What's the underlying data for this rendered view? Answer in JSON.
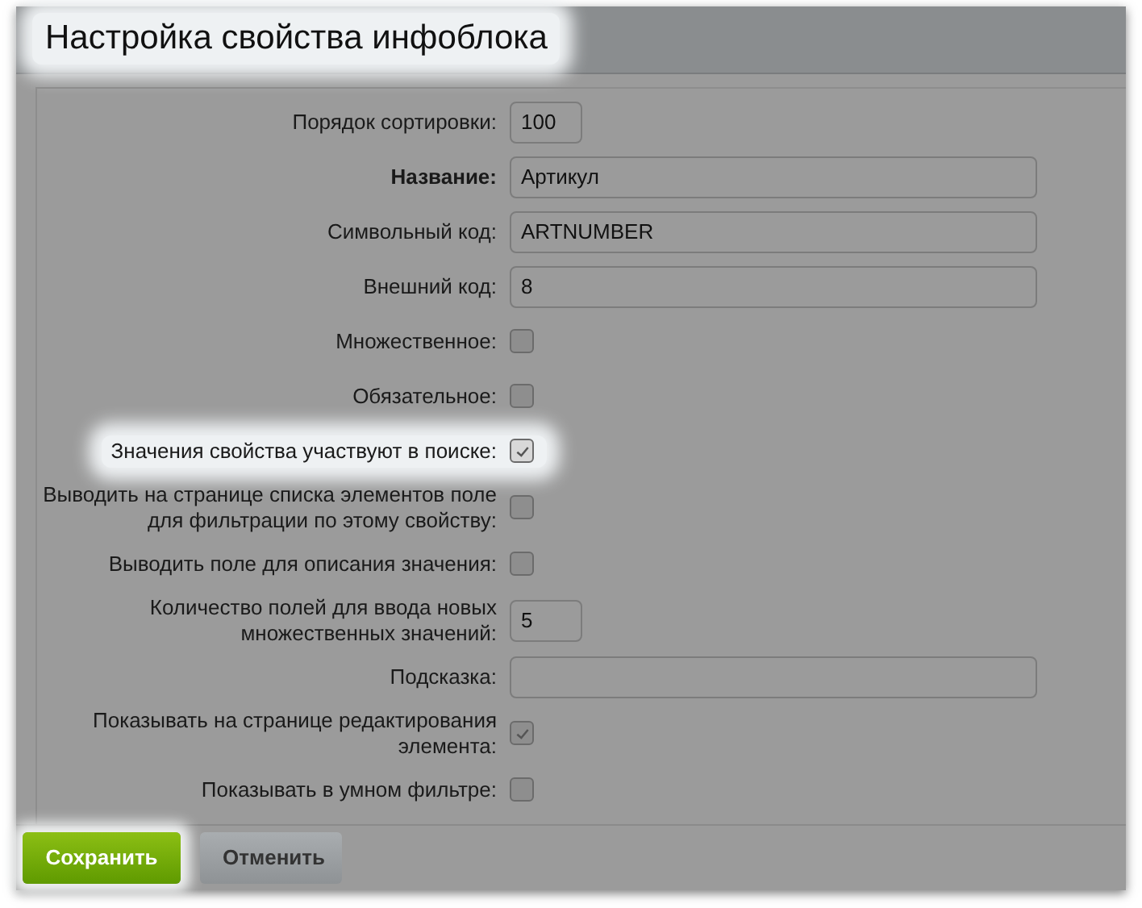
{
  "dialog": {
    "title": "Настройка свойства инфоблока",
    "title_highlighted": true
  },
  "fields": [
    {
      "kind": "short",
      "label": "Порядок сортировки:",
      "bold": false,
      "value": "100",
      "highlighted": false
    },
    {
      "kind": "text",
      "label": "Название:",
      "bold": true,
      "value": "Артикул",
      "highlighted": false
    },
    {
      "kind": "text",
      "label": "Символьный код:",
      "bold": false,
      "value": "ARTNUMBER",
      "highlighted": false
    },
    {
      "kind": "text",
      "label": "Внешний код:",
      "bold": false,
      "value": "8",
      "highlighted": false
    },
    {
      "kind": "checkbox",
      "label": "Множественное:",
      "bold": false,
      "checked": false,
      "highlighted": false
    },
    {
      "kind": "checkbox",
      "label": "Обязательное:",
      "bold": false,
      "checked": false,
      "highlighted": false
    },
    {
      "kind": "checkbox",
      "label": "Значения свойства участвуют в поиске:",
      "bold": false,
      "checked": true,
      "highlighted": true
    },
    {
      "kind": "checkbox",
      "label": "Выводить на странице списка элементов поле для фильтрации по этому свойству:",
      "bold": false,
      "checked": false,
      "highlighted": false
    },
    {
      "kind": "checkbox",
      "label": "Выводить поле для описания значения:",
      "bold": false,
      "checked": false,
      "highlighted": false
    },
    {
      "kind": "short",
      "label": "Количество полей для ввода новых множественных значений:",
      "bold": false,
      "value": "5",
      "highlighted": false
    },
    {
      "kind": "text",
      "label": "Подсказка:",
      "bold": false,
      "highlighted": false
    },
    {
      "kind": "checkbox",
      "label": "Показывать на странице редактирования элемента:",
      "bold": false,
      "checked": true,
      "highlighted": false
    },
    {
      "kind": "checkbox",
      "label": "Показывать в умном фильтре:",
      "bold": false,
      "checked": false,
      "highlighted": false
    }
  ],
  "buttons": [
    {
      "kind": "primary",
      "label": "Сохранить",
      "highlighted": true
    },
    {
      "kind": "secondary",
      "label": "Отменить",
      "highlighted": false
    }
  ]
}
